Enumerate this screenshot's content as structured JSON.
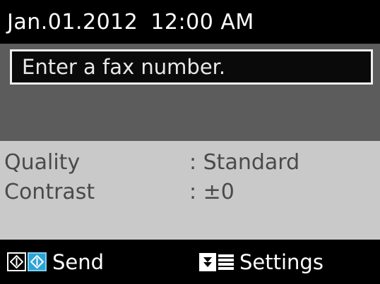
{
  "status": {
    "date": "Jan.01.2012",
    "time": "12:00 AM"
  },
  "fax_input": {
    "placeholder": "Enter a fax number.",
    "value": ""
  },
  "settings": [
    {
      "label": "Quality",
      "value": ": Standard"
    },
    {
      "label": "Contrast",
      "value": ": ±0"
    }
  ],
  "softkeys": {
    "send_label": "Send",
    "send_icon": "start-diamond-icons",
    "settings_label": "Settings",
    "settings_icon": "menu-icon"
  },
  "colors": {
    "background": "#000000",
    "input_panel": "#5c5c5c",
    "settings_panel": "#c9c9c9",
    "accent": "#2aa3d8"
  }
}
